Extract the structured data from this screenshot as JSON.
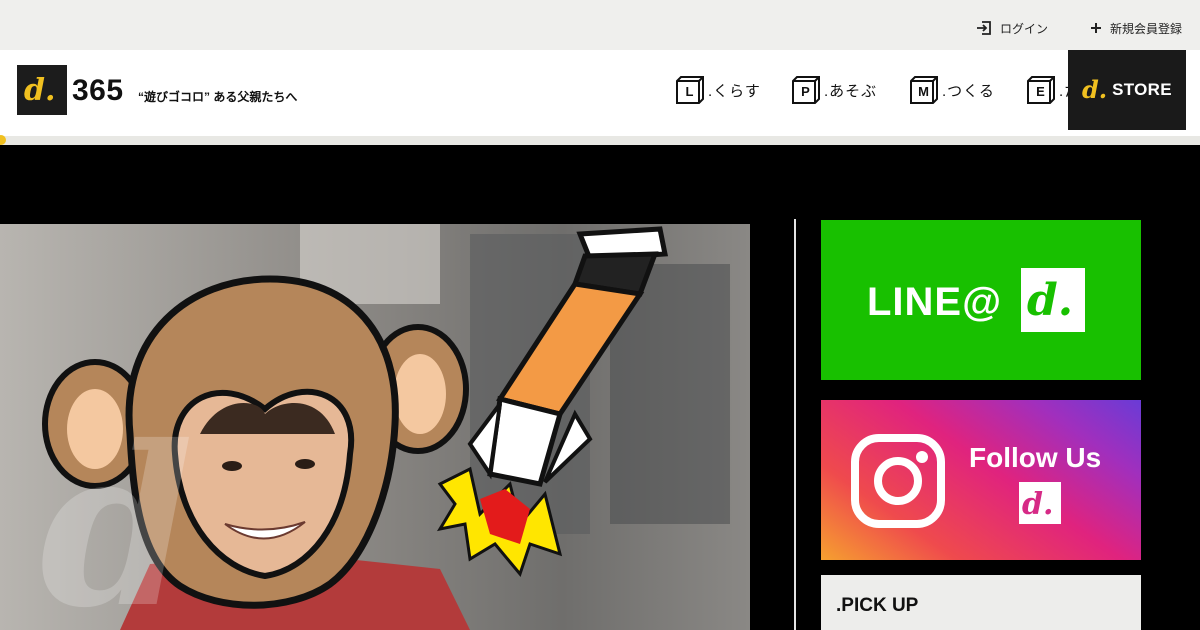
{
  "topbar": {
    "login_label": "ログイン",
    "register_label": "新規会員登録"
  },
  "header": {
    "logo_text": "d.",
    "logo_number": "365",
    "tagline": "“遊びゴコロ” ある父親たちへ",
    "nav": [
      {
        "letter": "L",
        "label": ".くらす"
      },
      {
        "letter": "P",
        "label": ".あそぶ"
      },
      {
        "letter": "M",
        "label": ".つくる"
      },
      {
        "letter": "E",
        "label": ".た"
      }
    ],
    "store": {
      "logo_text": "d.",
      "label": "STORE"
    }
  },
  "sidebar": {
    "line_banner": {
      "text": "LINE@",
      "logo_text": "d."
    },
    "instagram_banner": {
      "text": "Follow Us",
      "logo_text": "d."
    },
    "pickup_title": ".PICK UP"
  },
  "colors": {
    "accent_yellow": "#f0c020",
    "line_green": "#18c000",
    "dark": "#1a1a1a"
  }
}
